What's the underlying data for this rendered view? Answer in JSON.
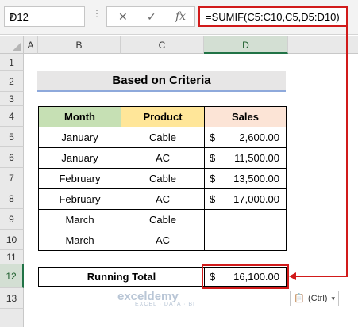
{
  "namebox": {
    "value": "D12"
  },
  "formula_bar": {
    "cancel_symbol": "✕",
    "enter_symbol": "✓",
    "fx_label": "fx",
    "formula": "=SUMIF(C5:C10,C5,D5:D10)"
  },
  "columns": [
    "A",
    "B",
    "C",
    "D"
  ],
  "rows": [
    "1",
    "2",
    "3",
    "4",
    "5",
    "6",
    "7",
    "8",
    "9",
    "10",
    "11",
    "12",
    "13"
  ],
  "title": "Based on Criteria",
  "table": {
    "headers": {
      "month": "Month",
      "product": "Product",
      "sales": "Sales"
    },
    "rows": [
      {
        "month": "January",
        "product": "Cable",
        "dollar": "$",
        "sales": "2,600.00"
      },
      {
        "month": "January",
        "product": "AC",
        "dollar": "$",
        "sales": "11,500.00"
      },
      {
        "month": "February",
        "product": "Cable",
        "dollar": "$",
        "sales": "13,500.00"
      },
      {
        "month": "February",
        "product": "AC",
        "dollar": "$",
        "sales": "17,000.00"
      },
      {
        "month": "March",
        "product": "Cable",
        "dollar": "",
        "sales": ""
      },
      {
        "month": "March",
        "product": "AC",
        "dollar": "",
        "sales": ""
      }
    ]
  },
  "total": {
    "label": "Running Total",
    "dollar": "$",
    "value": "16,100.00"
  },
  "paste_options": {
    "label": "(Ctrl)",
    "icon": "clipboard-icon"
  },
  "watermark": {
    "name": "exceldemy",
    "tagline": "EXCEL · DATA · BI"
  },
  "colors": {
    "month_header": "#c6e0b4",
    "product_header": "#ffe699",
    "sales_header": "#fce4d6",
    "highlight": "#d11a1a",
    "selection": "#217346"
  }
}
